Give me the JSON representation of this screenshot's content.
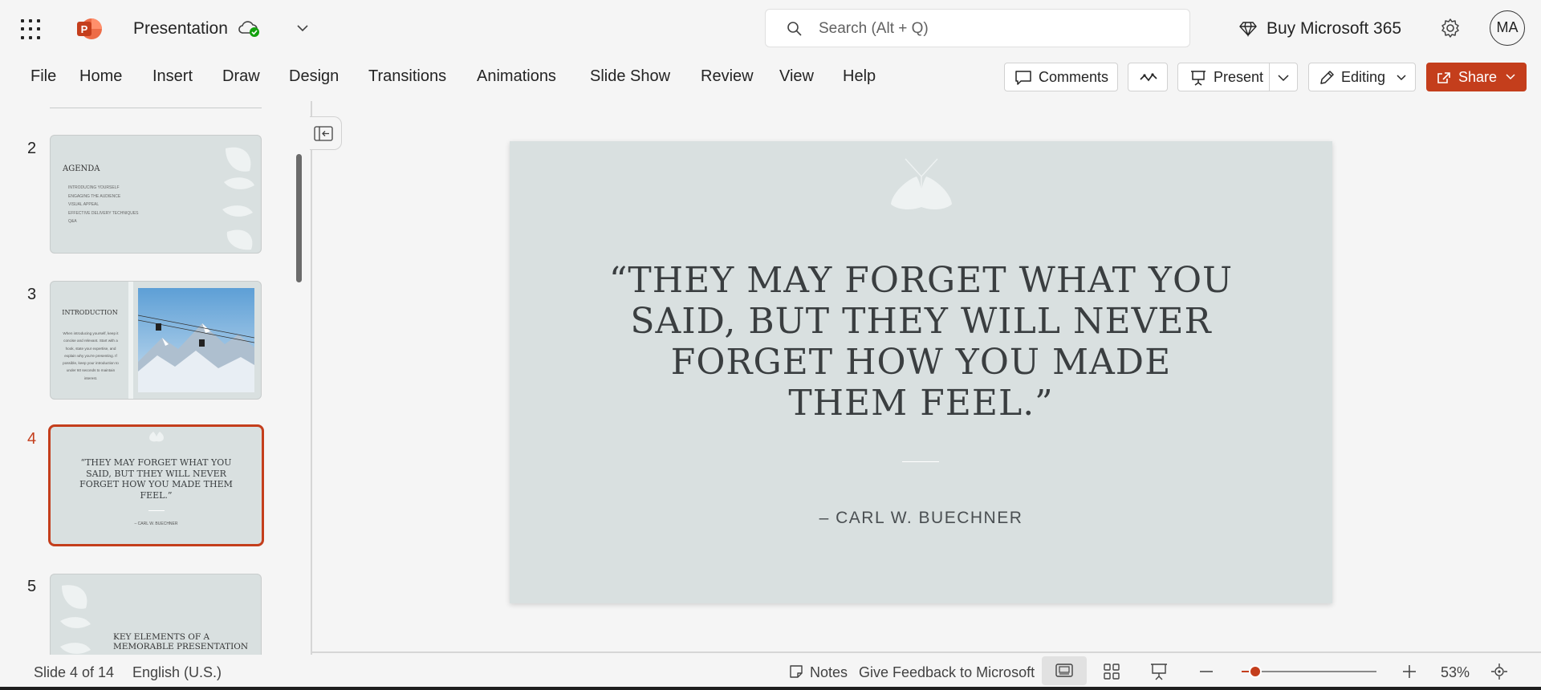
{
  "app": {
    "title": "Presentation",
    "search_placeholder": "Search (Alt + Q)",
    "buy_label": "Buy Microsoft 365",
    "avatar_initials": "MA",
    "brand_color": "#c43e1c"
  },
  "ribbon": {
    "tabs": [
      "File",
      "Home",
      "Insert",
      "Draw",
      "Design",
      "Transitions",
      "Animations",
      "Slide Show",
      "Review",
      "View",
      "Help"
    ],
    "comments_label": "Comments",
    "present_label": "Present",
    "editing_label": "Editing",
    "share_label": "Share"
  },
  "thumbnails": [
    {
      "number": "2",
      "title": "AGENDA",
      "bullets": [
        "INTRODUCING YOURSELF",
        "ENGAGING THE AUDIENCE",
        "VISUAL APPEAL",
        "EFFECTIVE DELIVERY TECHNIQUES",
        "Q&A"
      ]
    },
    {
      "number": "3",
      "title": "INTRODUCTION",
      "body": "When introducing yourself, keep it concise and relevant. Start with a hook, state your expertise, and explain why you're presenting. If possible, keep your introduction to under 60 seconds to maintain interest."
    },
    {
      "number": "4",
      "quote": "“THEY MAY FORGET WHAT YOU SAID, BUT THEY WILL NEVER FORGET HOW YOU MADE THEM FEEL.”",
      "author": "– CARL W. BUECHNER",
      "selected": true
    },
    {
      "number": "5",
      "title": "KEY ELEMENTS OF A MEMORABLE PRESENTATION"
    }
  ],
  "slide": {
    "quote": "“THEY MAY FORGET WHAT YOU SAID, BUT THEY WILL NEVER FORGET HOW YOU MADE THEM FEEL.”",
    "author": "– CARL W. BUECHNER"
  },
  "status": {
    "slide_position": "Slide 4 of 14",
    "language": "English (U.S.)",
    "notes_label": "Notes",
    "feedback_label": "Give Feedback to Microsoft",
    "zoom": "53%"
  }
}
